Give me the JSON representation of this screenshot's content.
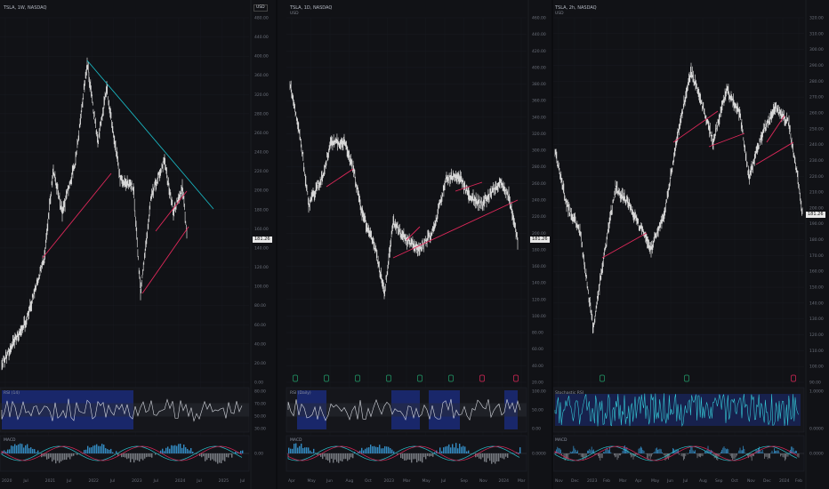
{
  "panes": [
    {
      "title": "TSLA, 1W, NASDAQ",
      "subtitle": "",
      "corner": "USD",
      "price_label": "181.26",
      "y_ticks": [
        "480.00",
        "440.00",
        "400.00",
        "360.00",
        "320.00",
        "280.00",
        "260.00",
        "240.00",
        "220.00",
        "200.00",
        "180.00",
        "160.00",
        "140.00",
        "120.00",
        "100.00",
        "80.00",
        "60.00",
        "40.00",
        "20.00",
        "0.00"
      ],
      "x_ticks": [
        "2020",
        "Jul",
        "2021",
        "Jul",
        "2022",
        "Jul",
        "2023",
        "Jul",
        "2024",
        "Jul",
        "2025",
        "Jul"
      ],
      "ind1_label": "RSI (14)",
      "ind1_ticks": [
        "80.00",
        "70.00",
        "50.00",
        "30.00"
      ],
      "ind2_label": "MACD",
      "ind2_ticks": [
        "0.00"
      ]
    },
    {
      "title": "TSLA, 1D, NASDAQ",
      "subtitle": "USD",
      "corner": "",
      "price_label": "181.26",
      "y_ticks": [
        "460.00",
        "440.00",
        "420.00",
        "400.00",
        "380.00",
        "360.00",
        "340.00",
        "320.00",
        "300.00",
        "280.00",
        "260.00",
        "240.00",
        "220.00",
        "200.00",
        "180.00",
        "160.00",
        "140.00",
        "120.00",
        "100.00",
        "80.00",
        "60.00",
        "40.00",
        "20.00"
      ],
      "x_ticks": [
        "Apr",
        "May",
        "Jun",
        "Aug",
        "Oct",
        "2023",
        "Mar",
        "May",
        "Jul",
        "Sep",
        "Nov",
        "2024",
        "Mar"
      ],
      "ind1_label": "RSI (Daily)",
      "ind1_ticks": [
        "100.00",
        "50.00",
        "0.00"
      ],
      "ind2_label": "MACD",
      "ind2_ticks": [
        "0.0000"
      ]
    },
    {
      "title": "TSLA, 2h, NASDAQ",
      "subtitle": "USD",
      "corner": "",
      "price_label": "181.26",
      "y_ticks": [
        "320.00",
        "310.00",
        "300.00",
        "290.00",
        "280.00",
        "270.00",
        "260.00",
        "250.00",
        "240.00",
        "230.00",
        "220.00",
        "210.00",
        "200.00",
        "190.00",
        "180.00",
        "170.00",
        "160.00",
        "150.00",
        "140.00",
        "130.00",
        "120.00",
        "110.00",
        "100.00",
        "90.00"
      ],
      "x_ticks": [
        "Nov",
        "Dec",
        "2023",
        "Feb",
        "Mar",
        "Apr",
        "May",
        "Jun",
        "Jul",
        "Aug",
        "Sep",
        "Oct",
        "Nov",
        "Dec",
        "2024",
        "Feb"
      ],
      "ind1_label": "Stochastic RSI",
      "ind1_ticks": [
        "1.0000",
        "0.0000"
      ],
      "ind2_label": "MACD",
      "ind2_ticks": [
        "0.0000"
      ]
    }
  ],
  "colors": {
    "candles": "#d7d7d7",
    "trend_up": "#e0285a",
    "trend_down": "#19b5c0",
    "rsi_band": "#1b2f8c",
    "macd_pos": "#3aa0e0",
    "macd_neg": "#e0285a",
    "bg": "#111216"
  }
}
